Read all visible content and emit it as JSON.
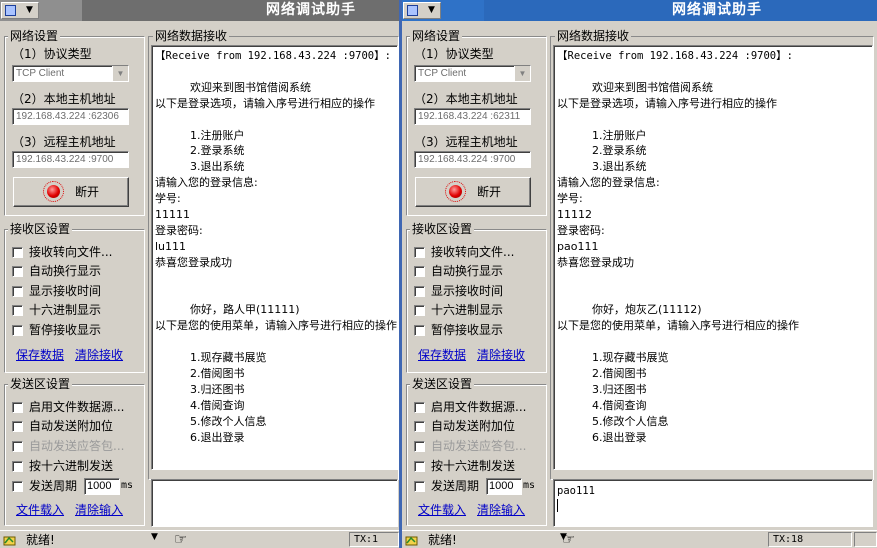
{
  "app_title": "网络调试助手",
  "windows": [
    {
      "net": {
        "group_title": "网络设置",
        "protocol_label": "（1）协议类型",
        "protocol_value": "TCP Client",
        "local_label": "（2）本地主机地址",
        "local_value": "192.168.43.224 :62306",
        "remote_label": "（3）远程主机地址",
        "remote_value": "192.168.43.224 :9700",
        "connect_button": "断开"
      },
      "recv_settings": {
        "group_title": "接收区设置",
        "options": [
          "接收转向文件...",
          "自动换行显示",
          "显示接收时间",
          "十六进制显示",
          "暂停接收显示"
        ],
        "save_link": "保存数据",
        "clear_link": "清除接收"
      },
      "send_settings": {
        "group_title": "发送区设置",
        "options": [
          "启用文件数据源...",
          "自动发送附加位",
          "自动发送应答包...",
          "按十六进制发送",
          "发送周期"
        ],
        "period_value": "1000",
        "period_unit": "ms",
        "load_link": "文件载入",
        "clear_link": "清除输入"
      },
      "recv_area": {
        "title": "网络数据接收",
        "lines": [
          "【Receive from 192.168.43.224 :9700】:",
          "",
          "          欢迎来到图书馆借阅系统",
          "以下是登录选项，请输入序号进行相应的操作",
          "",
          "          1.注册账户",
          "          2.登录系统",
          "          3.退出系统",
          "请输入您的登录信息:",
          "学号:",
          "11111",
          "登录密码:",
          "lu111",
          "恭喜您登录成功",
          "",
          "",
          "          你好，路人甲(11111)",
          "以下是您的使用菜单，请输入序号进行相应的操作",
          "",
          "          1.现存藏书展览",
          "          2.借阅图书",
          "          3.归还图书",
          "          4.借阅查询",
          "          5.修改个人信息",
          "          6.退出登录"
        ]
      },
      "send_area": {
        "text": ""
      },
      "status": {
        "text": "就绪!",
        "tx": "TX:1"
      }
    },
    {
      "net": {
        "group_title": "网络设置",
        "protocol_label": "（1）协议类型",
        "protocol_value": "TCP Client",
        "local_label": "（2）本地主机地址",
        "local_value": "192.168.43.224 :62311",
        "remote_label": "（3）远程主机地址",
        "remote_value": "192.168.43.224 :9700",
        "connect_button": "断开"
      },
      "recv_settings": {
        "group_title": "接收区设置",
        "options": [
          "接收转向文件...",
          "自动换行显示",
          "显示接收时间",
          "十六进制显示",
          "暂停接收显示"
        ],
        "save_link": "保存数据",
        "clear_link": "清除接收"
      },
      "send_settings": {
        "group_title": "发送区设置",
        "options": [
          "启用文件数据源...",
          "自动发送附加位",
          "自动发送应答包...",
          "按十六进制发送",
          "发送周期"
        ],
        "period_value": "1000",
        "period_unit": "ms",
        "load_link": "文件载入",
        "clear_link": "清除输入"
      },
      "recv_area": {
        "title": "网络数据接收",
        "lines": [
          "【Receive from 192.168.43.224 :9700】:",
          "",
          "          欢迎来到图书馆借阅系统",
          "以下是登录选项，请输入序号进行相应的操作",
          "",
          "          1.注册账户",
          "          2.登录系统",
          "          3.退出系统",
          "请输入您的登录信息:",
          "学号:",
          "11112",
          "登录密码:",
          "pao111",
          "恭喜您登录成功",
          "",
          "",
          "          你好，炮灰乙(11112)",
          "以下是您的使用菜单，请输入序号进行相应的操作",
          "",
          "          1.现存藏书展览",
          "          2.借阅图书",
          "          3.归还图书",
          "          4.借阅查询",
          "          5.修改个人信息",
          "          6.退出登录"
        ]
      },
      "send_area": {
        "text": "pao111"
      },
      "status": {
        "text": "就绪!",
        "tx": "TX:18"
      }
    }
  ]
}
